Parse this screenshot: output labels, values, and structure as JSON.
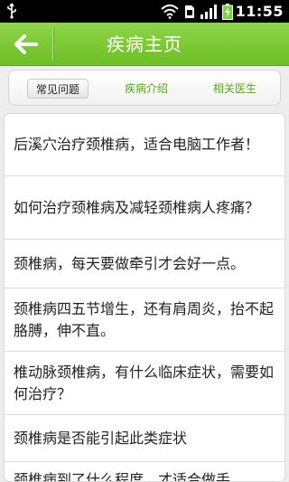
{
  "status_bar": {
    "time": "11:55",
    "icons": [
      "usb-icon",
      "wifi-icon",
      "sd-card-icon",
      "signal-icon",
      "battery-charging-icon"
    ]
  },
  "app_bar": {
    "title": "疾病主页",
    "back_icon": "back-arrow-icon",
    "color": "#7cc832"
  },
  "tabs": [
    {
      "label": "常见问题",
      "active": true
    },
    {
      "label": "疾病介绍",
      "active": false
    },
    {
      "label": "相关医生",
      "active": false
    }
  ],
  "questions": [
    "后溪穴治疗颈椎病，适合电脑工作者！",
    "如何治疗颈椎病及减轻颈椎病人疼痛？",
    "颈椎病，每天要做牵引才会好一点。",
    "颈椎病四五节增生，还有肩周炎，抬不起胳膊，伸不直。",
    "椎动脉颈椎病，有什么临床症状，需要如何治疗？",
    "颈椎病是否能引起此类症状",
    "颈椎病到了什么程度，才适合做手"
  ]
}
